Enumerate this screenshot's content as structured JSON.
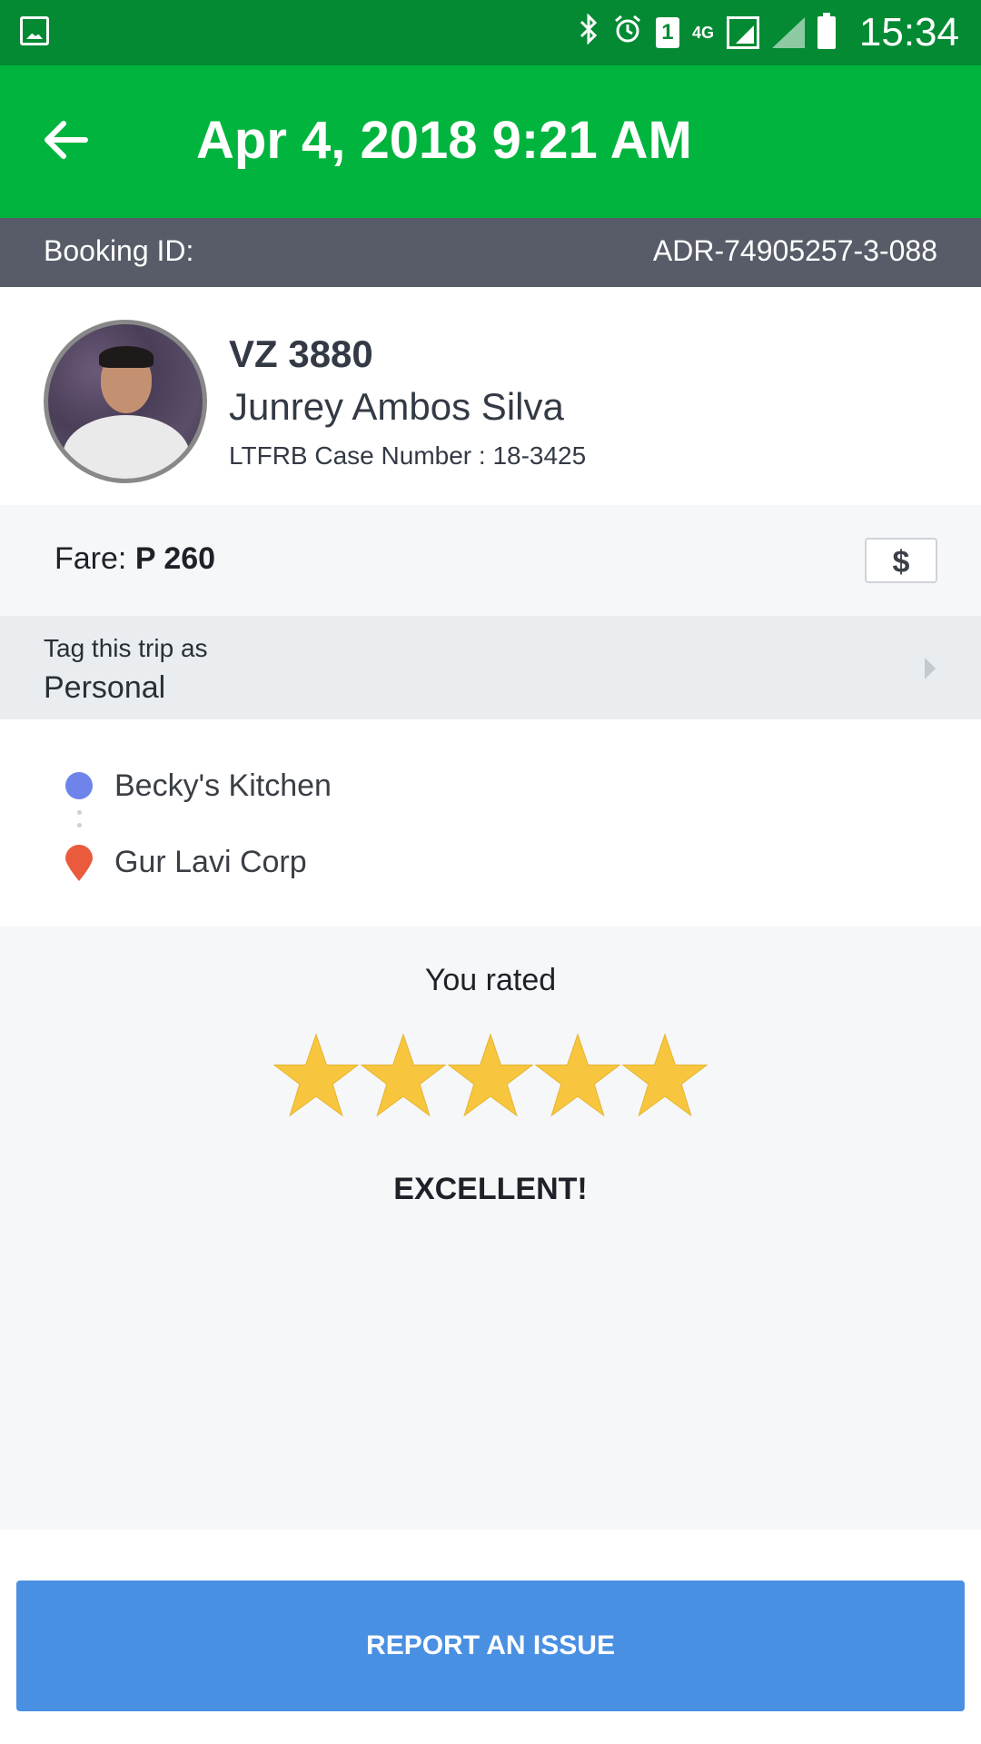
{
  "status_bar": {
    "time": "15:34",
    "icons": [
      "gallery-icon",
      "bluetooth-icon",
      "alarm-icon",
      "sim-icon",
      "network-4g-icon",
      "signal-icon",
      "signal-icon",
      "battery-icon"
    ],
    "sim_label": "1",
    "network_label": "4G"
  },
  "header": {
    "title": "Apr 4, 2018 9:21 AM",
    "back_icon": "back-arrow-icon",
    "color": "#00b43e"
  },
  "booking": {
    "label": "Booking ID:",
    "id": "ADR-74905257-3-088"
  },
  "driver": {
    "plate": "VZ 3880",
    "name": "Junrey Ambos Silva",
    "case_number": "LTFRB Case Number : 18-3425"
  },
  "fare": {
    "label": "Fare: ",
    "amount": "P 260",
    "icon_glyph": "$"
  },
  "tag": {
    "label": "Tag this trip as",
    "value": "Personal"
  },
  "route": {
    "pickup": "Becky's Kitchen",
    "dropoff": "Gur Lavi Corp",
    "pickup_color": "#6e84ea",
    "dropoff_color": "#ea5a3c"
  },
  "rating": {
    "label": "You rated",
    "stars": 5,
    "max_stars": 5,
    "verdict": "EXCELLENT!",
    "star_color": "#f7c63e"
  },
  "actions": {
    "report_label": "REPORT AN ISSUE",
    "report_color": "#4a90e2"
  }
}
